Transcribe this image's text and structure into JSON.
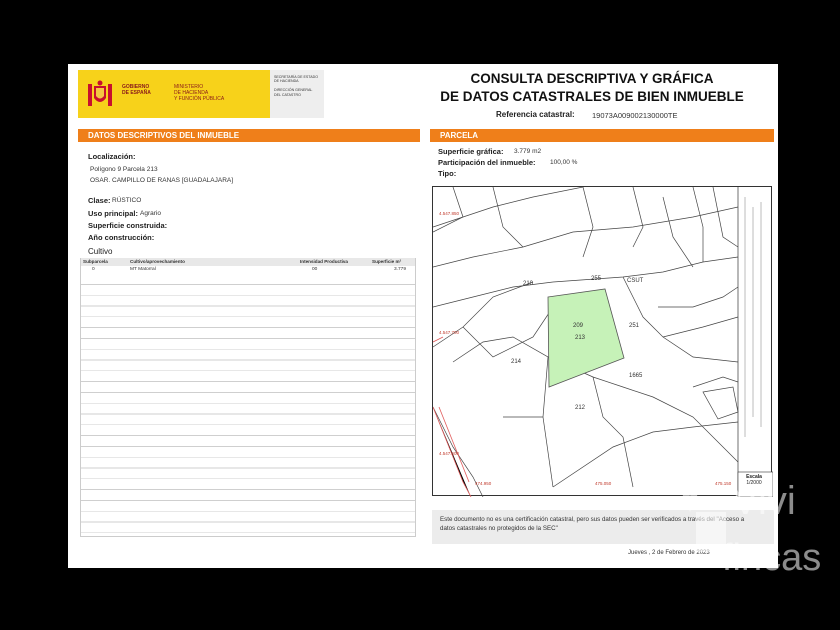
{
  "header": {
    "gobierno": "GOBIERNO\nDE ESPAÑA",
    "ministerio": "MINISTERIO\nDE HACIENDA\nY FUNCIÓN PÚBLICA",
    "secretaria": "SECRETARÍA DE ESTADO\nDE HACIENDA\n\nDIRECCIÓN GENERAL\nDEL CATASTRO",
    "title_line1": "CONSULTA DESCRIPTIVA Y GRÁFICA",
    "title_line2": "DE DATOS CATASTRALES DE BIEN INMUEBLE",
    "ref_label": "Referencia catastral:",
    "ref_value": "19073A009002130000TE"
  },
  "left": {
    "bar": "DATOS DESCRIPTIVOS DEL INMUEBLE",
    "localizacion_label": "Localización:",
    "localizacion_line1": "Polígono 9 Parcela 213",
    "localizacion_line2": "OSAR. CAMPILLO DE RANAS [GUADALAJARA]",
    "clase_label": "Clase:",
    "clase_value": "RÚSTICO",
    "uso_label": "Uso principal:",
    "uso_value": "Agrario",
    "superficie_label": "Superficie construida:",
    "anio_label": "Año construcción:",
    "cultivo_title": "Cultivo",
    "table_headers": [
      "Subparcela",
      "Cultivo/aprovechamiento",
      "Intensidad Productiva",
      "Superficie m²"
    ],
    "table_row": [
      "0",
      "MT Matorral",
      "00",
      "3.779"
    ]
  },
  "right": {
    "bar": "PARCELA",
    "sup_label": "Superficie gráfica:",
    "sup_value": "3.779 m2",
    "part_label": "Participación del inmueble:",
    "part_value": "100,00 %",
    "tipo_label": "Tipo:"
  },
  "map": {
    "parcels": [
      "210",
      "255",
      "CSUT",
      "209",
      "213",
      "251",
      "214",
      "1665",
      "212"
    ],
    "coords": [
      "4.547.850",
      "4.547.700",
      "4.547.600",
      "474.950",
      "475.050",
      "475.150"
    ],
    "highlight_color": "#c6f2b8",
    "scale_label": "Escala",
    "scale_value": "1/2000"
  },
  "footer": {
    "text": "Este documento no es una certificación catastral, pero sus datos pueden ser verificados a través del \"Acceso a datos catastrales no protegidos de la SEC\"",
    "date": "Jueves , 2 de Febrero de 2023"
  },
  "watermark": {
    "text1": "Vivi",
    "text2": "fincas"
  }
}
